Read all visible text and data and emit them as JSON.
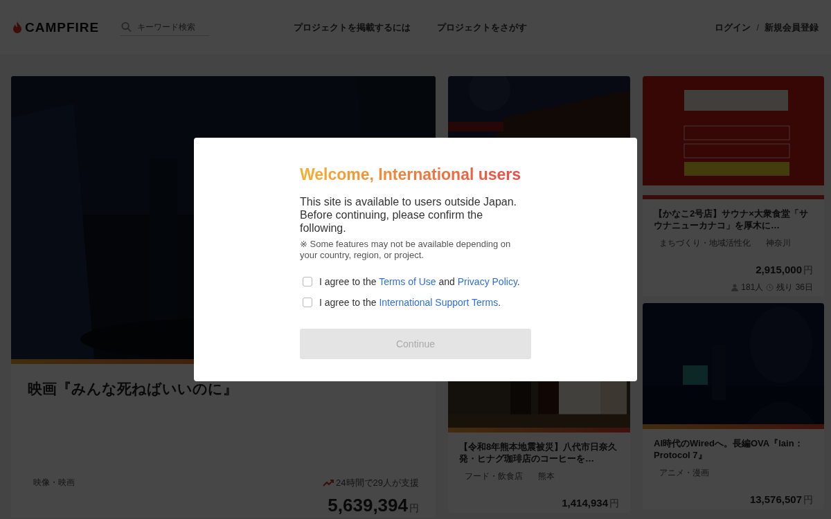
{
  "header": {
    "logo": "CAMPFIRE",
    "search": {
      "placeholder": "キーワード検索"
    },
    "nav": [
      "プロジェクトを掲載するには",
      "プロジェクトをさがす"
    ],
    "login": "ログイン",
    "separator": "/",
    "signup": "新規会員登録"
  },
  "featured": {
    "kind": "picture",
    "title": "映画『みんな死ねばいいのに』",
    "category": "映像・映画",
    "trend": "24時間で29人が支援",
    "amount": "5,639,394",
    "currency": "円"
  },
  "projects": [
    {
      "title": "【かなこ2号店】サウナ×大衆食堂「サウナニューカナコ」を厚木に…",
      "tags": [
        "まちづくり・地域活性化",
        "神奈川"
      ],
      "amount": "2,915,000",
      "currency": "円",
      "supporters": "181人",
      "remaining": "残り 36日"
    },
    {
      "title": "【令和8年熊本地震被災】八代市日奈久発・ヒナグ珈琲店のコーヒーを…",
      "tags": [
        "フード・飲食店",
        "熊本"
      ],
      "amount": "1,414,934",
      "currency": "円"
    },
    {
      "title": "AI時代のWiredへ。長編OVA『lain：Protocol 7』",
      "tags": [
        "アニメ・漫画"
      ],
      "amount": "13,576,507",
      "currency": "円"
    }
  ],
  "modal": {
    "title": "Welcome, International users",
    "body": "This site is available to users outside Japan. Before continuing, please confirm the following.",
    "note": "※ Some features may not be available depending on your country, region, or project.",
    "agreements": [
      {
        "checked": false,
        "parts": [
          {
            "kind": "text",
            "text": "I agree to the "
          },
          {
            "kind": "link",
            "text": "Terms of Use"
          },
          {
            "kind": "text",
            "text": " and "
          },
          {
            "kind": "link",
            "text": "Privacy Policy"
          },
          {
            "kind": "text",
            "text": "."
          }
        ]
      },
      {
        "checked": false,
        "parts": [
          {
            "kind": "text",
            "text": "I agree to the "
          },
          {
            "kind": "link",
            "text": "International Support Terms"
          },
          {
            "kind": "text",
            "text": "."
          }
        ]
      }
    ],
    "continue": {
      "label": "Continue",
      "disabled": true
    }
  }
}
